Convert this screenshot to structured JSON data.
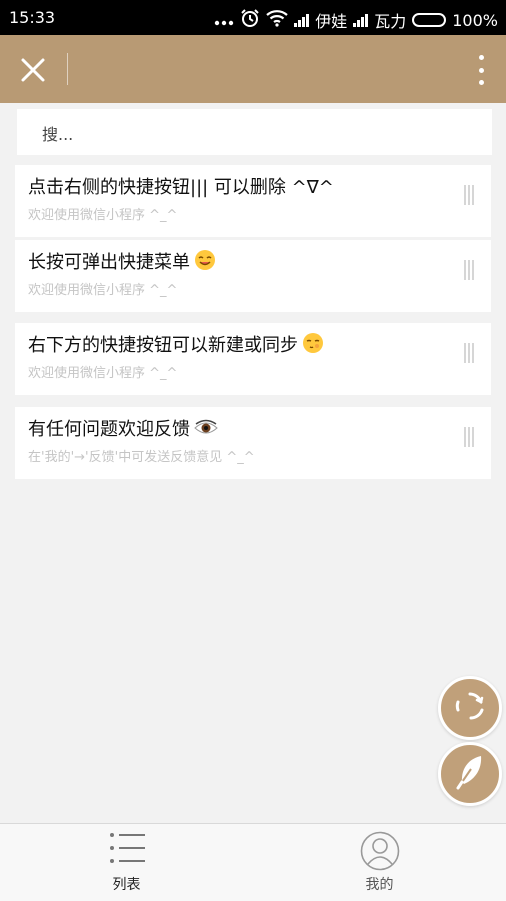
{
  "status_bar": {
    "time": "15:33",
    "carrier1": "伊娃",
    "carrier2": "瓦力",
    "battery": "100%"
  },
  "header": {
    "background_color": "#b89a74",
    "close_icon": "close-icon",
    "more_icon": "more-vertical-icon"
  },
  "search": {
    "placeholder": "搜..."
  },
  "items": [
    {
      "title": "点击右侧的快捷按钮||| 可以删除 ^∇^",
      "subtitle": "欢迎使用微信小程序 ^_^"
    },
    {
      "title": "长按可弹出快捷菜单",
      "subtitle": "欢迎使用微信小程序 ^_^",
      "emoji": "smiling-face-emoji"
    },
    {
      "title": "右下方的快捷按钮可以新建或同步",
      "subtitle": "欢迎使用微信小程序 ^_^",
      "emoji": "blushing-face-emoji"
    },
    {
      "title": "有任何问题欢迎反馈",
      "subtitle": "在'我的'→'反馈'中可发送反馈意见 ^_^",
      "emoji": "eye-emoji"
    }
  ],
  "fabs": {
    "sync_icon": "sync-icon",
    "new_icon": "feather-icon",
    "color": "#c0a07a"
  },
  "tabbar": {
    "tabs": [
      {
        "label": "列表",
        "icon": "list-icon"
      },
      {
        "label": "我的",
        "icon": "profile-icon"
      }
    ]
  }
}
